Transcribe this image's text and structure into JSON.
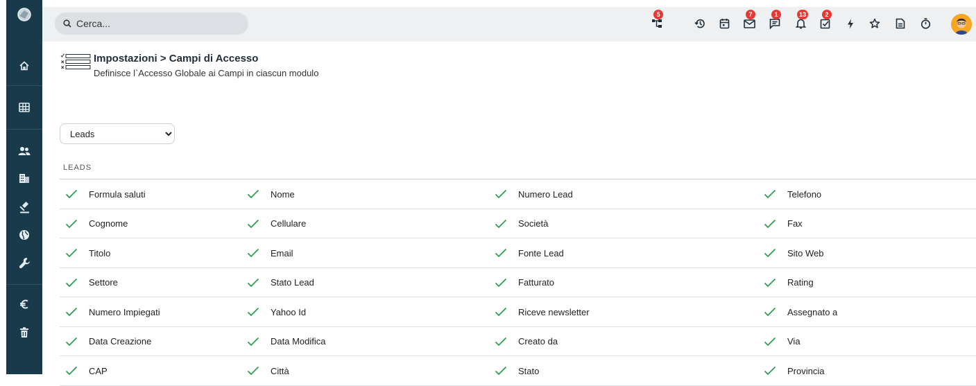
{
  "search": {
    "placeholder": "Cerca..."
  },
  "toolbar": {
    "badges": {
      "workflow": "5",
      "mail": "7",
      "chat": "1",
      "notifications": "13",
      "tasks": "2"
    }
  },
  "header": {
    "title": "Impostazioni > Campi di Accesso",
    "subtitle": "Definisce l`Accesso Globale ai Campi in ciascun modulo"
  },
  "module_select": {
    "selected": "Leads"
  },
  "section": {
    "label": "LEADS"
  },
  "fields": [
    [
      "Formula saluti",
      "Nome",
      "Numero Lead",
      "Telefono"
    ],
    [
      "Cognome",
      "Cellulare",
      "Società",
      "Fax"
    ],
    [
      "Titolo",
      "Email",
      "Fonte Lead",
      "Sito Web"
    ],
    [
      "Settore",
      "Stato Lead",
      "Fatturato",
      "Rating"
    ],
    [
      "Numero Impiegati",
      "Yahoo Id",
      "Riceve newsletter",
      "Assegnato a"
    ],
    [
      "Data Creazione",
      "Data Modifica",
      "Creato da",
      "Via"
    ],
    [
      "CAP",
      "Città",
      "Stato",
      "Provincia"
    ]
  ],
  "colors": {
    "sidebar": "#183a4a",
    "check": "#2e9e4f",
    "badge": "#e53935",
    "topbar": "#eef0f2"
  },
  "icons": {
    "sidebar": [
      "logo-icon",
      "home-icon",
      "grid-icon",
      "users-icon",
      "building-icon",
      "gavel-icon",
      "globe-icon",
      "wrench-icon",
      "euro-icon",
      "trash-icon"
    ],
    "toolbar": [
      "workflow-icon",
      "history-icon",
      "calendar-icon",
      "mail-icon",
      "chat-icon",
      "bell-icon",
      "task-icon",
      "bolt-icon",
      "star-icon",
      "document-icon",
      "timer-icon"
    ]
  }
}
